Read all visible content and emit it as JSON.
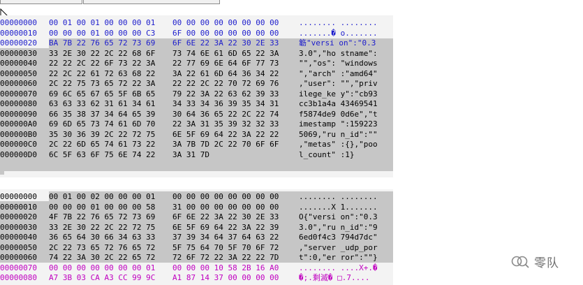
{
  "colors": {
    "blue_text": "#1c1ccc",
    "black_text": "#000000",
    "purple_text": "#c000c0",
    "selection": "#c6c6c6",
    "panel_bg": "#f3f3f3"
  },
  "dump1": [
    {
      "addr": "00000000",
      "hex1": "00 01 00 01 00 00 00 01",
      "hex2": "00 00 00 00 00 00 00 00",
      "ascii": "........ ........",
      "style": "blue"
    },
    {
      "addr": "00000010",
      "hex1": "00 00 00 01 00 00 00 C3",
      "hex2": "6F 00 00 00 00 00 00 00",
      "ascii": ".......� o.......",
      "style": "blue"
    },
    {
      "addr": "00000020",
      "hex1": "BA 7B 22 76 65 72 73 69",
      "hex2": "6F 6E 22 3A 22 30 2E 33",
      "ascii": "簕\"versi on\":\"0.3",
      "style": "blue-sel"
    },
    {
      "addr": "00000030",
      "hex1": "33 2E 30 22 2C 22 68 6F",
      "hex2": "73 74 6E 61 6D 65 22 3A",
      "ascii": "3.0\",\"ho stname\":",
      "style": "black"
    },
    {
      "addr": "00000040",
      "hex1": "22 22 2C 22 6F 73 22 3A",
      "hex2": "22 77 69 6E 64 6F 77 73",
      "ascii": "\"\",\"os\": \"windows",
      "style": "black"
    },
    {
      "addr": "00000050",
      "hex1": "22 2C 22 61 72 63 68 22",
      "hex2": "3A 22 61 6D 64 36 34 22",
      "ascii": "\",\"arch\" :\"amd64\"",
      "style": "black"
    },
    {
      "addr": "00000060",
      "hex1": "2C 22 75 73 65 72 22 3A",
      "hex2": "22 22 2C 22 70 72 69 76",
      "ascii": ",\"user\": \"\",\"priv",
      "style": "black"
    },
    {
      "addr": "00000070",
      "hex1": "69 6C 65 67 65 5F 6B 65",
      "hex2": "79 22 3A 22 63 62 39 33",
      "ascii": "ilege_ke y\":\"cb93",
      "style": "black"
    },
    {
      "addr": "00000080",
      "hex1": "63 63 33 62 31 61 34 61",
      "hex2": "34 33 34 36 39 35 34 31",
      "ascii": "cc3b1a4a 43469541",
      "style": "black"
    },
    {
      "addr": "00000090",
      "hex1": "66 35 38 37 34 64 65 39",
      "hex2": "30 64 36 65 22 2C 22 74",
      "ascii": "f5874de9 0d6e\",\"t",
      "style": "black"
    },
    {
      "addr": "000000A0",
      "hex1": "69 6D 65 73 74 61 6D 70",
      "hex2": "22 3A 31 35 39 32 32 33",
      "ascii": "imestamp \":159223",
      "style": "black"
    },
    {
      "addr": "000000B0",
      "hex1": "35 30 36 39 2C 22 72 75",
      "hex2": "6E 5F 69 64 22 3A 22 22",
      "ascii": "5069,\"ru n_id\":\"\"",
      "style": "black"
    },
    {
      "addr": "000000C0",
      "hex1": "2C 22 6D 65 74 61 73 22",
      "hex2": "3A 7B 7D 2C 22 70 6F 6F",
      "ascii": ",\"metas\" :{},\"poo",
      "style": "black"
    },
    {
      "addr": "000000D0",
      "hex1": "6C 5F 63 6F 75 6E 74 22",
      "hex2": "3A 31 7D",
      "ascii": "l_count\" :1}",
      "style": "black"
    }
  ],
  "dump2": [
    {
      "addr": "00000000",
      "hex1": "00 01 00 02 00 00 00 01",
      "hex2": "00 00 00 00 00 00 00 00",
      "ascii": "........ ........",
      "style": "black"
    },
    {
      "addr": "00000010",
      "hex1": "00 00 00 01 00 00 00 58",
      "hex2": "31 00 00 00 00 00 00 00",
      "ascii": ".......X 1.......",
      "style": "black"
    },
    {
      "addr": "00000020",
      "hex1": "4F 7B 22 76 65 72 73 69",
      "hex2": "6F 6E 22 3A 22 30 2E 33",
      "ascii": "O{\"versi on\":\"0.3",
      "style": "black"
    },
    {
      "addr": "00000030",
      "hex1": "33 2E 30 22 2C 22 72 75",
      "hex2": "6E 5F 69 64 22 3A 22 39",
      "ascii": "3.0\",\"ru n_id\":\"9",
      "style": "black"
    },
    {
      "addr": "00000040",
      "hex1": "36 65 64 30 66 34 63 33",
      "hex2": "37 39 34 64 37 64 63 22",
      "ascii": "6ed0f4c3 794d7dc\"",
      "style": "black"
    },
    {
      "addr": "00000050",
      "hex1": "2C 22 73 65 72 76 65 72",
      "hex2": "5F 75 64 70 5F 70 6F 72",
      "ascii": ",\"server _udp_por",
      "style": "black"
    },
    {
      "addr": "00000060",
      "hex1": "74 22 3A 30 2C 22 65 72",
      "hex2": "72 6F 72 22 3A 22 22 7D",
      "ascii": "t\":0,\"er ror\":\"\"}",
      "style": "black"
    },
    {
      "addr": "00000070",
      "hex1": "00 00 00 00 00 00 00 01",
      "hex2": "00 00 00 10 58 2B 16 A0",
      "ascii": "........ ....X+.�",
      "style": "purple"
    },
    {
      "addr": "00000080",
      "hex1": "A7 3B 03 CA A3 CC 99 9C",
      "hex2": "A1 87 14 37 00 00 00 00",
      "ascii": "�;.剩滅� □.7....",
      "style": "purple"
    }
  ],
  "watermark": {
    "text": "零队",
    "icon": "wechat-search-icon"
  }
}
